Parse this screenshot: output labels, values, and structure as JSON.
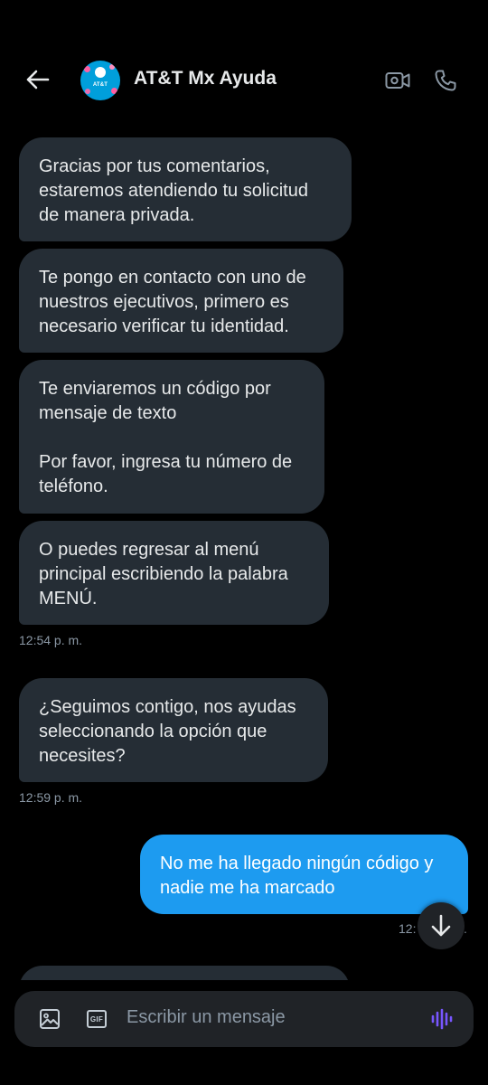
{
  "header": {
    "title": "AT&T Mx Ayuda",
    "avatar_logo_text": "AT&T",
    "icons": {
      "back": "arrow-left-icon",
      "video": "video-camera-icon",
      "call": "phone-icon"
    }
  },
  "messages": [
    {
      "direction": "in",
      "text": "Gracias por tus comentarios,\nestaremos atendiendo tu solicitud\nde manera privada."
    },
    {
      "direction": "in",
      "text": "Te pongo en contacto con uno de\nnuestros ejecutivos, primero es\nnecesario verificar tu identidad."
    },
    {
      "direction": "in",
      "text": "Te enviaremos un código por\nmensaje de texto\n\nPor favor, ingresa tu número de\nteléfono."
    },
    {
      "direction": "in",
      "text": "O puedes regresar al menú\nprincipal escribiendo la palabra\nMENÚ."
    },
    {
      "direction": "in",
      "text": "¿Seguimos contigo, nos ayudas\nseleccionando la opción que\nnecesites?"
    },
    {
      "direction": "out",
      "text": "No me ha llegado ningún código y\nnadie me ha marcado"
    }
  ],
  "timestamps": {
    "t1": "12:54 p. m.",
    "t2": "12:59 p. m.",
    "t3_partial_left": "12:",
    "t3_partial_right": "."
  },
  "composer": {
    "placeholder": "Escribir un mensaje",
    "gif_label": "GIF",
    "icons": {
      "image": "image-icon",
      "gif": "gif-icon",
      "voice": "voice-wave-icon"
    }
  },
  "colors": {
    "background": "#000000",
    "incoming_bubble": "#252d35",
    "outgoing_bubble": "#1d9bf0",
    "voice_accent": "#7856ff",
    "brand": "#009fdb"
  }
}
